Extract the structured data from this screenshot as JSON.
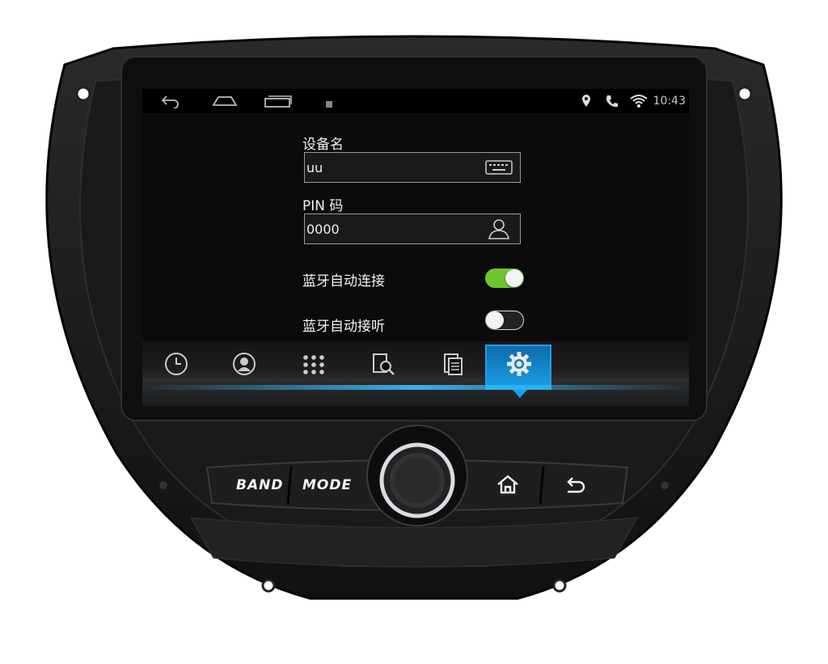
{
  "status_bar": {
    "time": "10:43",
    "nav_icons": [
      "back-icon",
      "home-icon",
      "recent-apps-icon"
    ],
    "notification_icon": "screenshot-icon",
    "status_icons": [
      "location-icon",
      "phone-icon",
      "wifi-icon"
    ]
  },
  "settings": {
    "device_name_label": "设备名",
    "device_name_value": "uu",
    "pin_label": "PIN 码",
    "pin_value": "0000",
    "auto_connect_label": "蓝牙自动连接",
    "auto_connect_on": true,
    "auto_answer_label": "蓝牙自动接听",
    "auto_answer_on": false
  },
  "dock": {
    "tabs": [
      "call-log-icon",
      "contacts-icon",
      "dialpad-icon",
      "search-device-icon",
      "file-transfer-icon",
      "settings-gear-icon"
    ],
    "active": "settings-gear-icon"
  },
  "hardware": {
    "band_label": "BAND",
    "mode_label": "MODE",
    "home_icon": "home-icon",
    "return_icon": "return-icon"
  },
  "colors": {
    "toggle_on": "#6dc72f",
    "toggle_off": "#222222",
    "active_tab": "#1aa0e8",
    "screen_bg": "#0b0b0b"
  }
}
